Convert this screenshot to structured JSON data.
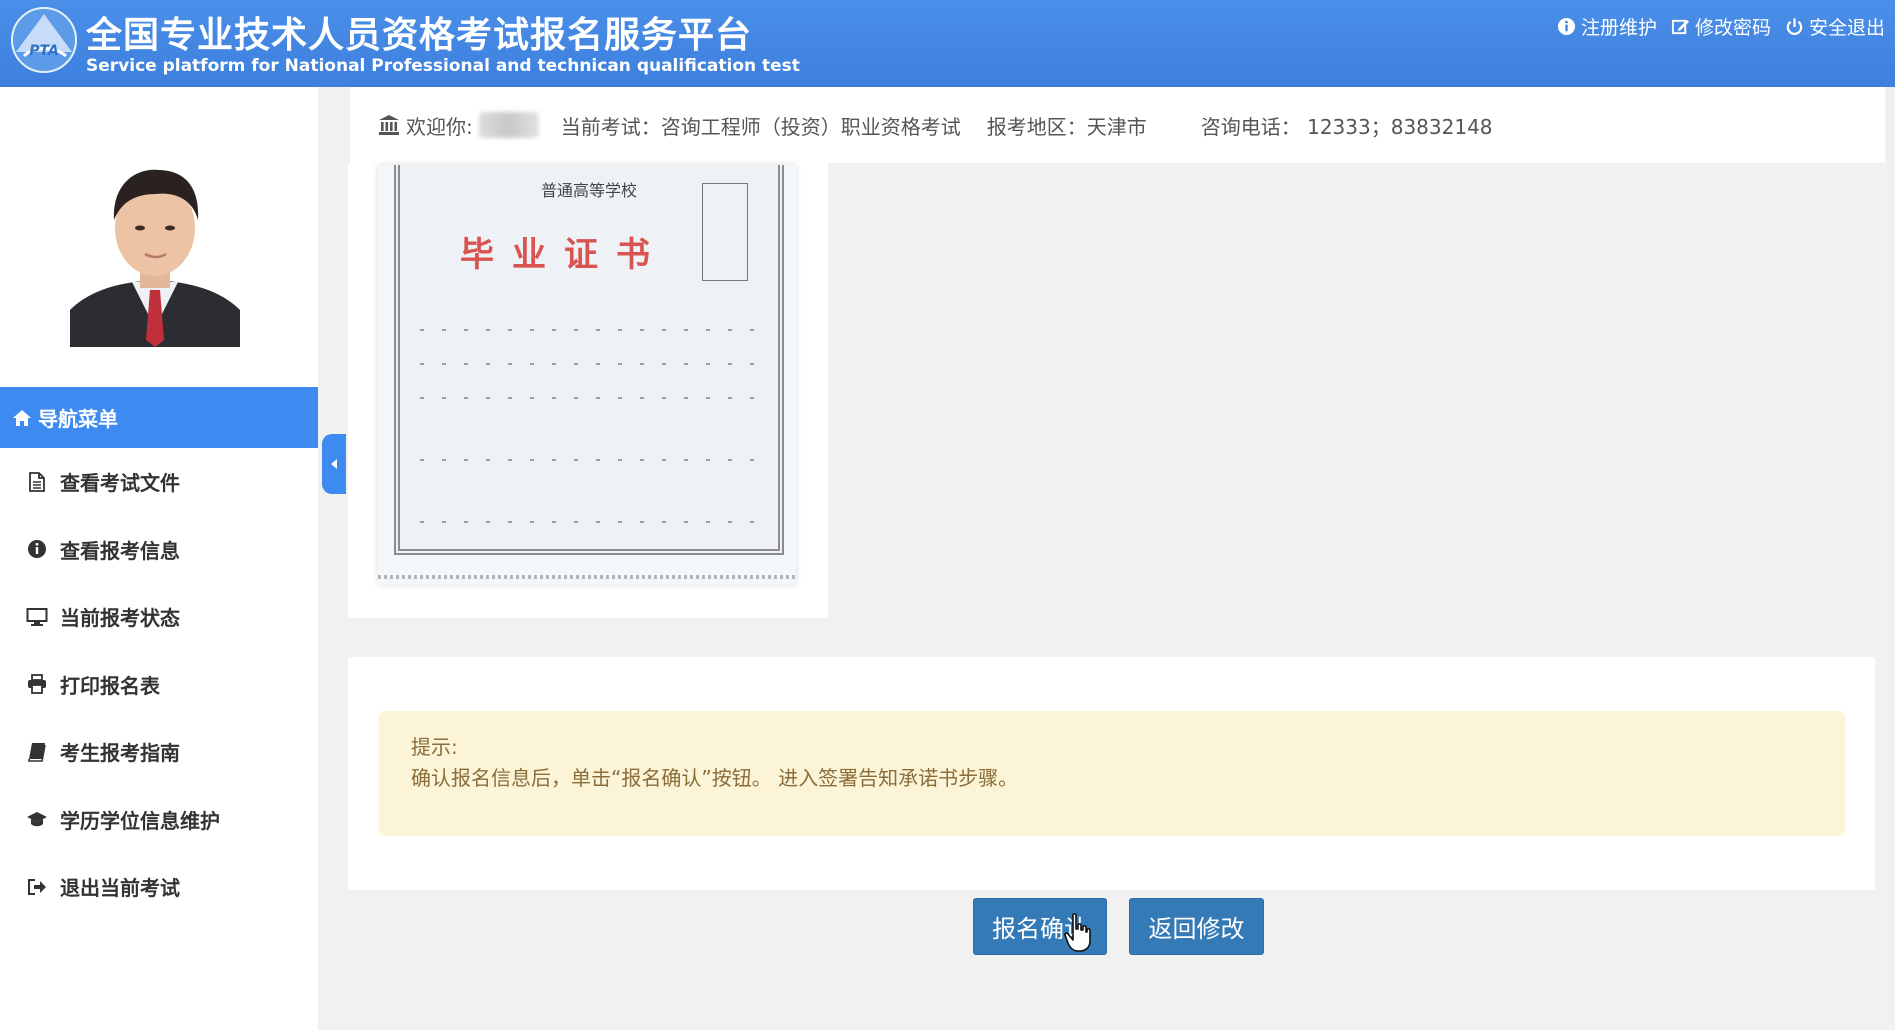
{
  "header": {
    "title_cn": "全国专业技术人员资格考试报名服务平台",
    "title_en": "Service platform for National Professional and technican qualification test",
    "logo_text": "PTA",
    "links": [
      {
        "label": "注册维护",
        "icon": "info-icon"
      },
      {
        "label": "修改密码",
        "icon": "edit-icon"
      },
      {
        "label": "安全退出",
        "icon": "power-icon"
      }
    ]
  },
  "sidebar": {
    "nav_header": "导航菜单",
    "items": [
      {
        "label": "查看考试文件",
        "icon": "file-icon"
      },
      {
        "label": "查看报考信息",
        "icon": "info-circle-icon"
      },
      {
        "label": "当前报考状态",
        "icon": "monitor-icon"
      },
      {
        "label": "打印报名表",
        "icon": "printer-icon"
      },
      {
        "label": "考生报考指南",
        "icon": "book-icon"
      },
      {
        "label": "学历学位信息维护",
        "icon": "graduation-cap-icon"
      },
      {
        "label": "退出当前考试",
        "icon": "sign-out-icon"
      }
    ]
  },
  "info_bar": {
    "welcome": "欢迎你:",
    "exam": "当前考试：咨询工程师（投资）职业资格考试",
    "region": "报考地区：天津市",
    "phone": "咨询电话： 12333；83832148"
  },
  "certificate": {
    "school": "普通高等学校",
    "title": "毕业证书"
  },
  "tip": {
    "label": "提示:",
    "text": "确认报名信息后，单击“报名确认”按钮。 进入签署告知承诺书步骤。"
  },
  "buttons": {
    "confirm": "报名确认",
    "back": "返回修改"
  },
  "colors": {
    "header_bg": "#3d7fdd",
    "nav_active": "#3d8af0",
    "button": "#337ab7",
    "tip_bg": "#fcf4d6",
    "tip_text": "#8a6d3b",
    "cert_title": "#d9534f"
  }
}
